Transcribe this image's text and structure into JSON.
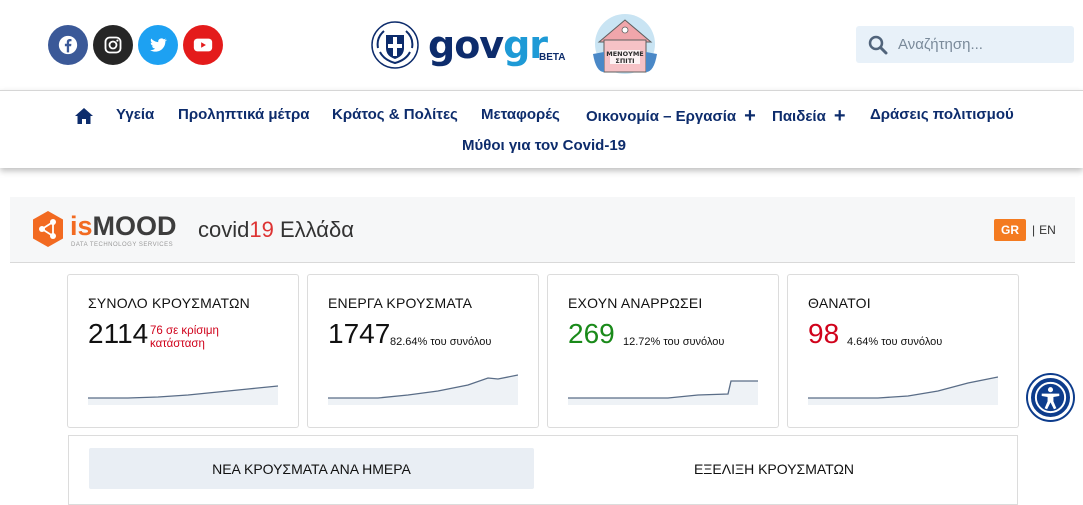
{
  "social": [
    {
      "name": "facebook-icon",
      "color": "#3b5998"
    },
    {
      "name": "instagram-icon",
      "color": "#262626"
    },
    {
      "name": "twitter-icon",
      "color": "#1da1f2"
    },
    {
      "name": "youtube-icon",
      "color": "#e41b1b"
    }
  ],
  "logo": {
    "brand_main": "gov",
    "brand_accent": "gr",
    "badge": "BETA",
    "house_text": "ΜΕΝΟΥΜΕ ΣΠΙΤΙ"
  },
  "search": {
    "placeholder": "Αναζήτηση..."
  },
  "nav": {
    "home_icon": "home-icon",
    "items": [
      "Υγεία",
      "Προληπτικά μέτρα",
      "Κράτος & Πολίτες",
      "Μεταφορές",
      "Οικονομία – Εργασία",
      "Παιδεία",
      "Δράσεις πολιτισμού",
      "Μύθοι για τον Covid-19"
    ],
    "expand_symbol": "+"
  },
  "ismood": {
    "brand_prefix": "is",
    "brand": "MOOD",
    "tagline": "DATA TECHNOLOGY SERVICES",
    "title_prefix": "covid",
    "title_number": "19",
    "title_suffix": " Ελλάδα",
    "lang_active": "GR",
    "lang_separator": "|",
    "lang_other": "EN"
  },
  "cards": [
    {
      "title": "ΣΥΝΟΛΟ ΚΡΟΥΣΜΑΤΩΝ",
      "value": "2114",
      "note": "76 σε κρίσιμη κατάσταση",
      "value_color": "#111111"
    },
    {
      "title": "ΕΝΕΡΓΑ ΚΡΟΥΣΜΑΤΑ",
      "value": "1747",
      "sub": "82.64% του συνόλου",
      "value_color": "#111111"
    },
    {
      "title": "ΕΧΟΥΝ ΑΝΑΡΡΩΣΕΙ",
      "value": "269",
      "sub": "12.72% του συνόλου",
      "value_color": "#1a8a1a"
    },
    {
      "title": "ΘΑΝΑΤΟΙ",
      "value": "98",
      "sub": "4.64% του συνόλου",
      "value_color": "#d0021b"
    }
  ],
  "tabs": {
    "active": "ΝΕΑ ΚΡΟΥΣΜΑΤΑ ΑΝΑ ΗΜΕΡΑ",
    "other": "ΕΞΕΛΙΞΗ ΚΡΟΥΣΜΑΤΩΝ"
  },
  "accessibility": {
    "icon": "accessibility-icon"
  },
  "colors": {
    "nav_text": "#0d2c6c",
    "accent_orange": "#f47b20",
    "search_bg": "#e8f1f9"
  }
}
